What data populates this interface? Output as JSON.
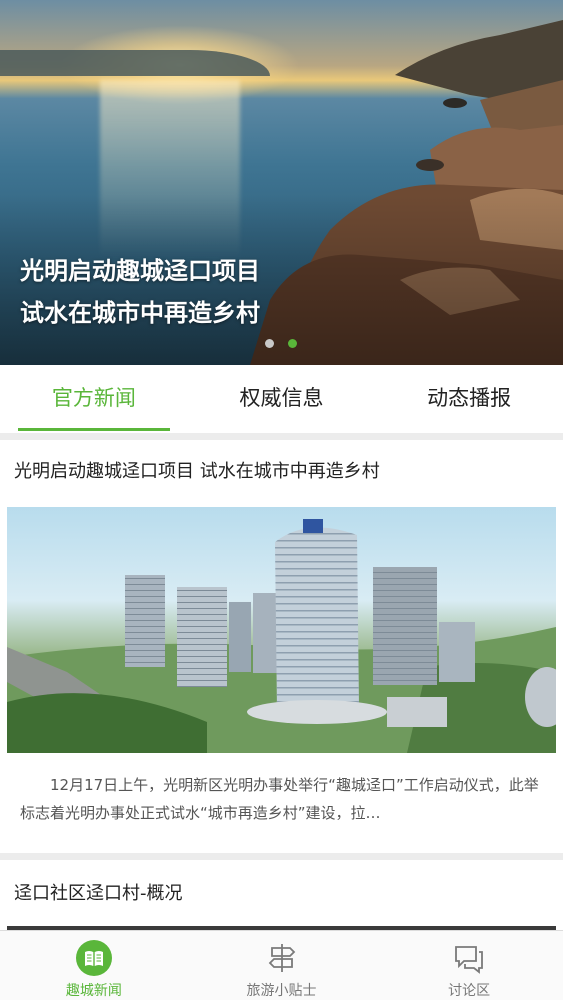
{
  "banner": {
    "caption_line1": "光明启动趣城迳口项目",
    "caption_line2": "试水在城市中再造乡村",
    "slides_total": 2,
    "slide_active": 2
  },
  "tabs": [
    {
      "label": "官方新闻",
      "active": true
    },
    {
      "label": "权威信息",
      "active": false
    },
    {
      "label": "动态播报",
      "active": false
    }
  ],
  "feed": [
    {
      "title": "光明启动趣城迳口项目 试水在城市中再造乡村",
      "summary": "12月17日上午，光明新区光明办事处举行“趣城迳口”工作启动仪式，此举标志着光明办事处正式试水“城市再造乡村”建设，拉…"
    },
    {
      "title": "迳口社区迳口村-概况"
    }
  ],
  "bottom_nav": [
    {
      "label": "趣城新闻",
      "icon": "book-icon",
      "active": true
    },
    {
      "label": "旅游小贴士",
      "icon": "signpost-icon",
      "active": false
    },
    {
      "label": "讨论区",
      "icon": "chat-icon",
      "active": false
    }
  ],
  "colors": {
    "accent": "#5ab63a",
    "text": "#222222",
    "muted": "#777777",
    "background": "#ececec"
  }
}
